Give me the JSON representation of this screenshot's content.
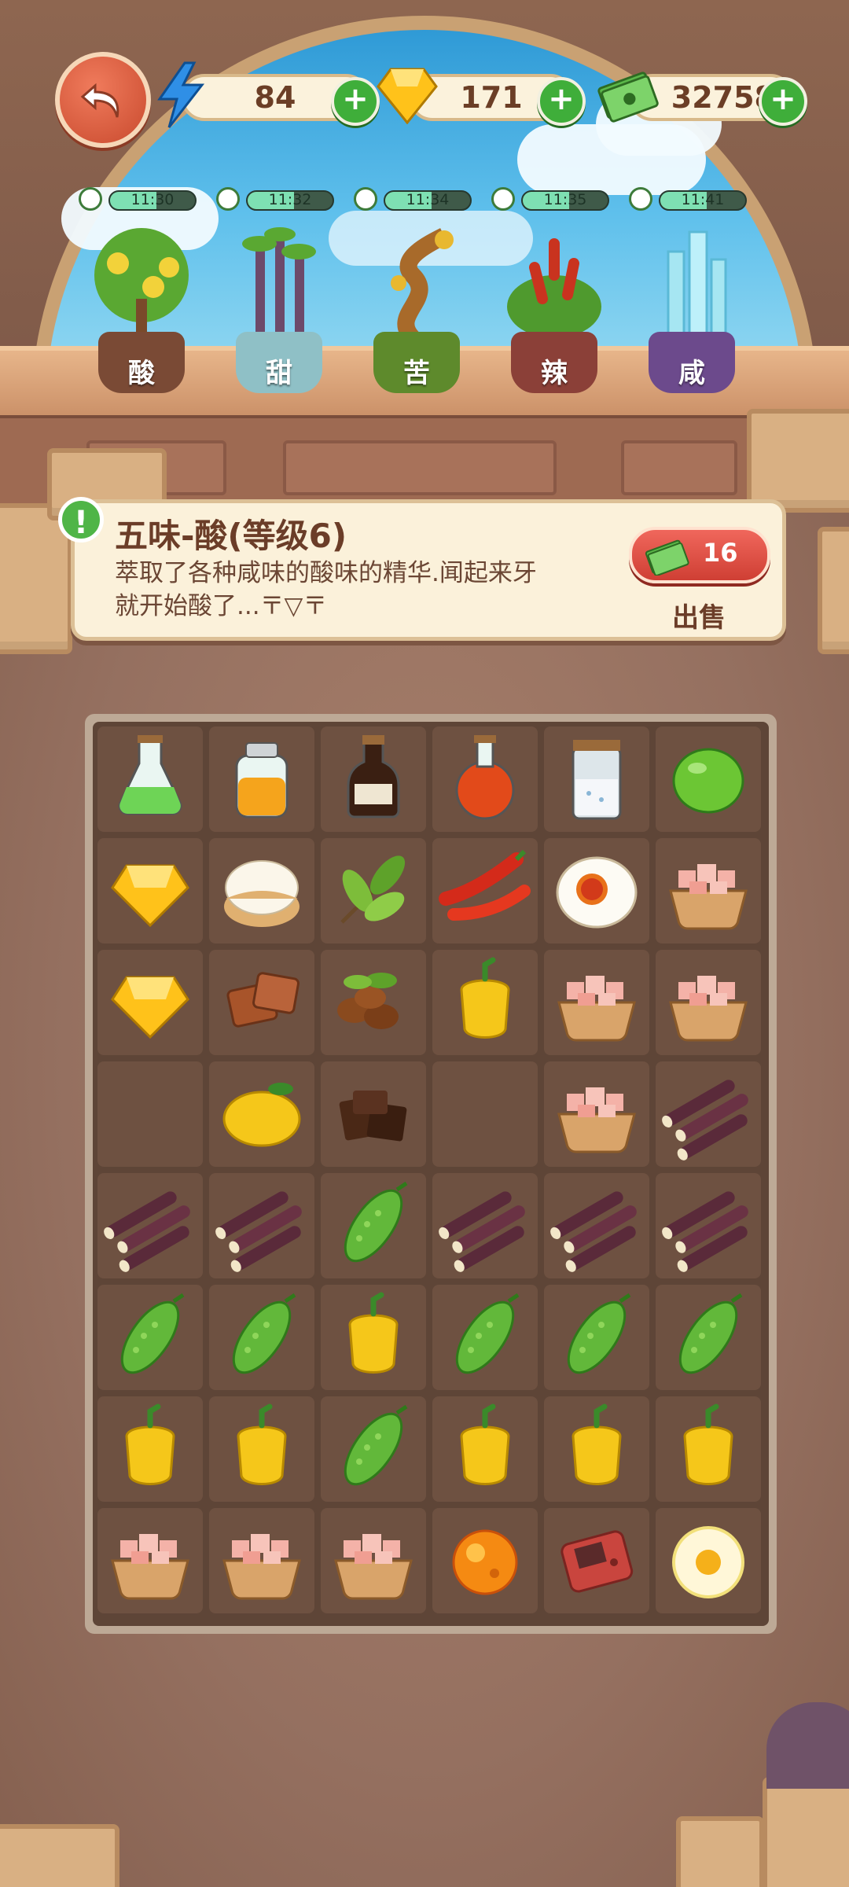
{
  "hud": {
    "energy": "84",
    "gems": "171",
    "cash": "32758",
    "plus": "+"
  },
  "plants": [
    {
      "timer": "11:30",
      "label": "酸",
      "fill": 0.55,
      "pot_color": "#7a4a35"
    },
    {
      "timer": "11:32",
      "label": "甜",
      "fill": 0.55,
      "pot_color": "#8fc0c6"
    },
    {
      "timer": "11:34",
      "label": "苦",
      "fill": 0.55,
      "pot_color": "#5e8a2c"
    },
    {
      "timer": "11:35",
      "label": "辣",
      "fill": 0.55,
      "pot_color": "#8b4038"
    },
    {
      "timer": "11:41",
      "label": "咸",
      "fill": 0.55,
      "pot_color": "#6c4a8c"
    }
  ],
  "info": {
    "badge": "!",
    "title": "五味-酸(等级6)",
    "desc_line1": "萃取了各种咸味的酸味的精华.闻起来牙",
    "desc_line2": "就开始酸了...〒▽〒",
    "sell_price": "16",
    "sell_label": "出售"
  },
  "grid": {
    "cols": 6,
    "rows": 8,
    "cells": [
      [
        "flask-green",
        "jar-orange",
        "bottle-soy",
        "flask-red",
        "jar-salt",
        "lime"
      ],
      [
        "gem",
        "cream-puff",
        "tea-leaves",
        "chili",
        "salted-egg",
        "meat-bowl"
      ],
      [
        "gem",
        "brown-sugar",
        "coffee-beans",
        "pepper",
        "meat-bowl",
        "meat-bowl"
      ],
      [
        "empty",
        "lemon",
        "chocolate",
        "empty",
        "meat-bowl",
        "sugarcane"
      ],
      [
        "sugarcane",
        "sugarcane",
        "bitter-melon",
        "sugarcane",
        "sugarcane",
        "sugarcane"
      ],
      [
        "bitter-melon",
        "bitter-melon",
        "pepper",
        "bitter-melon",
        "bitter-melon",
        "bitter-melon"
      ],
      [
        "pepper",
        "pepper",
        "bitter-melon",
        "pepper",
        "pepper",
        "pepper"
      ],
      [
        "meat-bowl",
        "meat-bowl",
        "meat-bowl",
        "fire-orb",
        "game-console",
        "fried-egg"
      ]
    ]
  },
  "colors": {
    "sky": "#4fb3e6",
    "board": "#5e4537",
    "accent_green": "#3fae3a",
    "sell_red": "#d9473b"
  }
}
